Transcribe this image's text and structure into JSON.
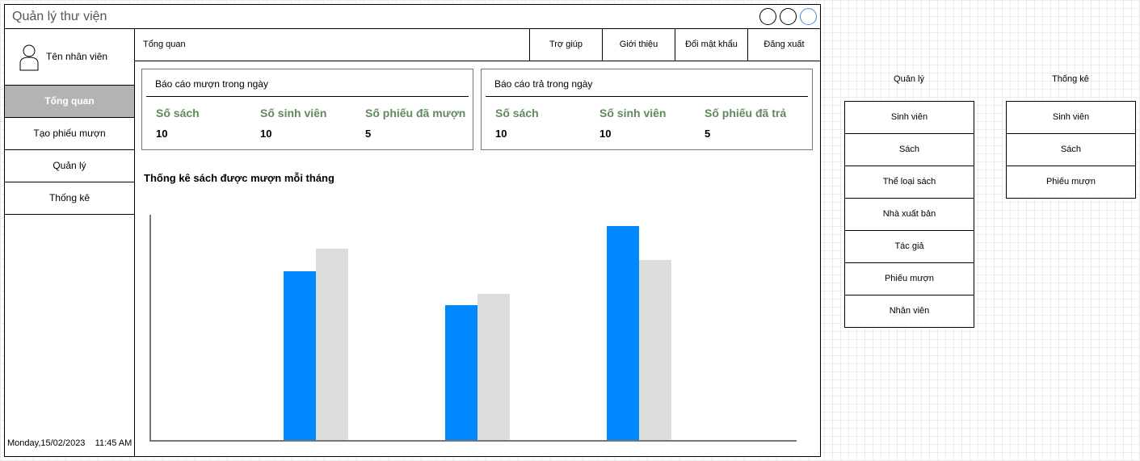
{
  "app": {
    "title": "Quản lý thư viện"
  },
  "sidebar": {
    "user_name": "Tên nhân viên",
    "items": [
      {
        "label": "Tổng quan",
        "active": true
      },
      {
        "label": "Tạo phiếu mượn",
        "active": false
      },
      {
        "label": "Quản lý",
        "active": false
      },
      {
        "label": "Thống kê",
        "active": false
      }
    ],
    "date": "Monday,15/02/2023",
    "time": "11:45 AM"
  },
  "topnav": {
    "title": "Tổng quan",
    "buttons": [
      "Trợ giúp",
      "Giới thiệu",
      "Đổi mật khẩu",
      "Đăng xuất"
    ]
  },
  "borrow_card": {
    "title": "Báo cáo mượn trong ngày",
    "stats": [
      {
        "label": "Số sách",
        "value": "10"
      },
      {
        "label": "Số sinh viên",
        "value": "10"
      },
      {
        "label": "Số phiếu đã mượn",
        "value": "5"
      }
    ]
  },
  "return_card": {
    "title": "Báo cáo trả trong ngày",
    "stats": [
      {
        "label": "Số sách",
        "value": "10"
      },
      {
        "label": "Số sinh viên",
        "value": "10"
      },
      {
        "label": "Số phiếu đã trả",
        "value": "5"
      }
    ]
  },
  "chart_data": {
    "type": "bar",
    "title": "Thống kê sách được mượn mỗi tháng",
    "categories": [
      "",
      "",
      ""
    ],
    "series": [
      {
        "values": [
          75,
          60,
          95
        ],
        "color": "#0088ff"
      },
      {
        "values": [
          85,
          65,
          80
        ],
        "color": "#dddddd"
      }
    ],
    "ylim": [
      0,
      100
    ],
    "xlabel": "",
    "ylabel": "",
    "grid": false
  },
  "panels": {
    "quan_ly": {
      "title": "Quản lý",
      "items": [
        "Sinh viên",
        "Sách",
        "Thể loại sách",
        "Nhà xuất bản",
        "Tác giả",
        "Phiếu mượn",
        "Nhân viên"
      ]
    },
    "thong_ke": {
      "title": "Thống kê",
      "items": [
        "Sinh viên",
        "Sách",
        "Phiếu mượn"
      ]
    }
  }
}
